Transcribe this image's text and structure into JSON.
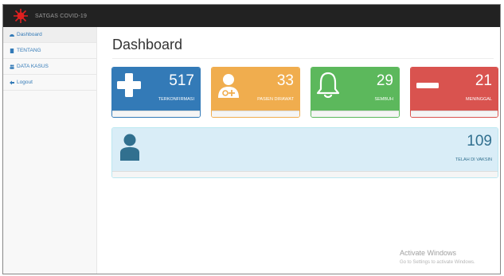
{
  "brand": {
    "title": "SATGAS COVID-19"
  },
  "sidebar": {
    "items": [
      {
        "label": "Dashboard",
        "icon": "dashboard-icon"
      },
      {
        "label": "TENTANG",
        "icon": "file-icon"
      },
      {
        "label": "DATA KASUS",
        "icon": "users-icon"
      },
      {
        "label": "Logout",
        "icon": "sign-out-icon"
      }
    ]
  },
  "main": {
    "title": "Dashboard",
    "panels": [
      {
        "value": "517",
        "label": "TERKONFIRMASI",
        "icon": "plus-icon",
        "color": "#337ab7"
      },
      {
        "value": "33",
        "label": "PASIEN DIRAWAT",
        "icon": "user-md-icon",
        "color": "#f0ad4e"
      },
      {
        "value": "29",
        "label": "SEMBUH",
        "icon": "bell-icon",
        "color": "#5cb85c"
      },
      {
        "value": "21",
        "label": "MENINGGAL",
        "icon": "minus-icon",
        "color": "#d9534f"
      }
    ],
    "vaccine": {
      "value": "109",
      "label": "TELAH DI VAKSIN",
      "icon": "user-icon",
      "color": "#d9edf7"
    }
  },
  "watermark": {
    "title": "Activate Windows",
    "subtitle": "Go to Settings to activate Windows."
  }
}
